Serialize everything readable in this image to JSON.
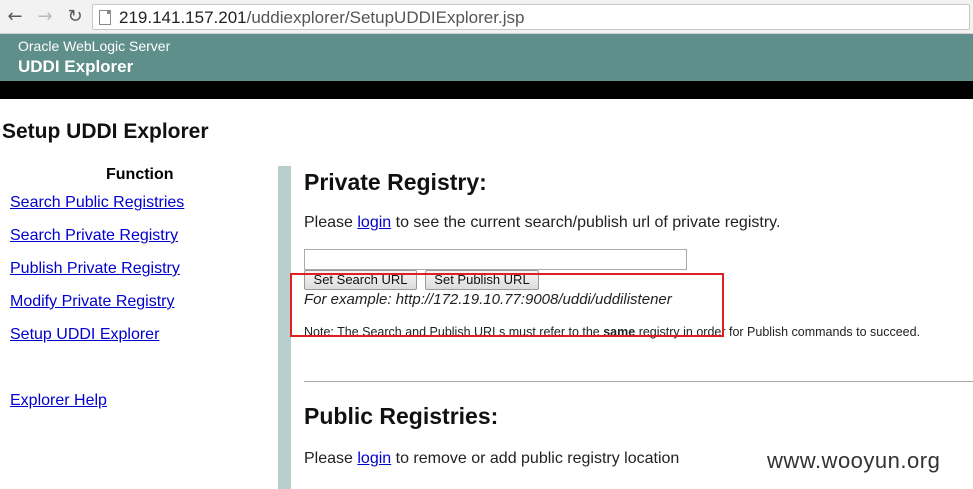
{
  "browser": {
    "back_icon": "←",
    "forward_icon": "→",
    "reload_icon": "↻",
    "url_host": "219.141.157.201",
    "url_path": "/uddiexplorer/SetupUDDIExplorer.jsp"
  },
  "header": {
    "product": "Oracle WebLogic Server",
    "app": "UDDI Explorer",
    "color": "#5f8f8a"
  },
  "page": {
    "title": "Setup UDDI Explorer"
  },
  "sidebar": {
    "function_header": "Function",
    "links": [
      "Search Public Registries",
      "Search Private Registry",
      "Publish Private Registry",
      "Modify Private Registry",
      "Setup UDDI Explorer"
    ],
    "help_link": "Explorer Help"
  },
  "private_registry": {
    "heading": "Private Registry:",
    "text_before": "Please ",
    "login_label": "login",
    "text_after": " to see the current search/publish url of private registry.",
    "input_value": "",
    "search_button": "Set Search URL",
    "publish_button": "Set Publish URL",
    "example": "For example: http://172.19.10.77:9008/uddi/uddilistener",
    "note_before": "Note: The Search and Publish URLs must refer to the ",
    "note_bold": "same",
    "note_after": " registry in order for Publish commands to succeed."
  },
  "public_registries": {
    "heading": "Public Registries:",
    "text_before": "Please ",
    "login_label": "login",
    "text_after": " to remove or add public registry location"
  },
  "annotation": {
    "highlight_color": "#e02020"
  },
  "watermark": "www.wooyun.org"
}
